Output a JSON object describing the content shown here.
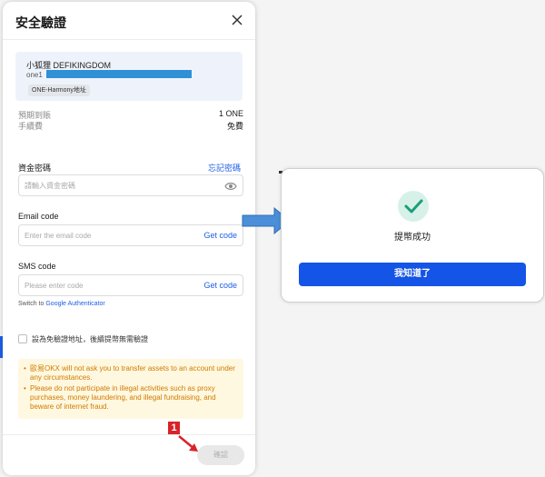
{
  "dialog": {
    "title": "安全驗證",
    "address_card": {
      "name": "小狐狸 DEFIKINGDOM",
      "address_prefix": "one1",
      "network_tag": "ONE-Harmony地址"
    },
    "info": [
      {
        "label": "預期到賬",
        "value": "1 ONE"
      },
      {
        "label": "手續費",
        "value": "免費"
      }
    ],
    "fund_password": {
      "label": "資金密碼",
      "forgot_link": "忘記密碼",
      "placeholder": "請輸入資金密碼"
    },
    "email_code": {
      "label": "Email code",
      "placeholder": "Enter the email code",
      "get_code": "Get code"
    },
    "sms_code": {
      "label": "SMS code",
      "placeholder": "Please enter code",
      "get_code": "Get code"
    },
    "switch": {
      "prefix": "Switch to",
      "link": "Google Authenticator"
    },
    "checkbox_label": "設為免驗證地址，後續提幣無需驗證",
    "notices": [
      "歐易OKX will not ask you to transfer assets to an account under any circumstances.",
      "Please do not participate in illegal activities such as proxy purchases, money laundering, and illegal fundraising, and beware of internet fraud."
    ],
    "confirm_label": "確認"
  },
  "annotation": {
    "step_badge": "1",
    "badge_color": "#d8232a"
  },
  "success_dialog": {
    "message": "提幣成功",
    "button_label": "我知道了",
    "accent_color": "#1454e6"
  },
  "colors": {
    "link": "#1e5fe6",
    "notice_text": "#d07a00",
    "notice_bg": "#fff8e0",
    "redaction": "#2f90d6",
    "success_check": "#1a9e79",
    "success_circle": "#d7f1e8"
  }
}
